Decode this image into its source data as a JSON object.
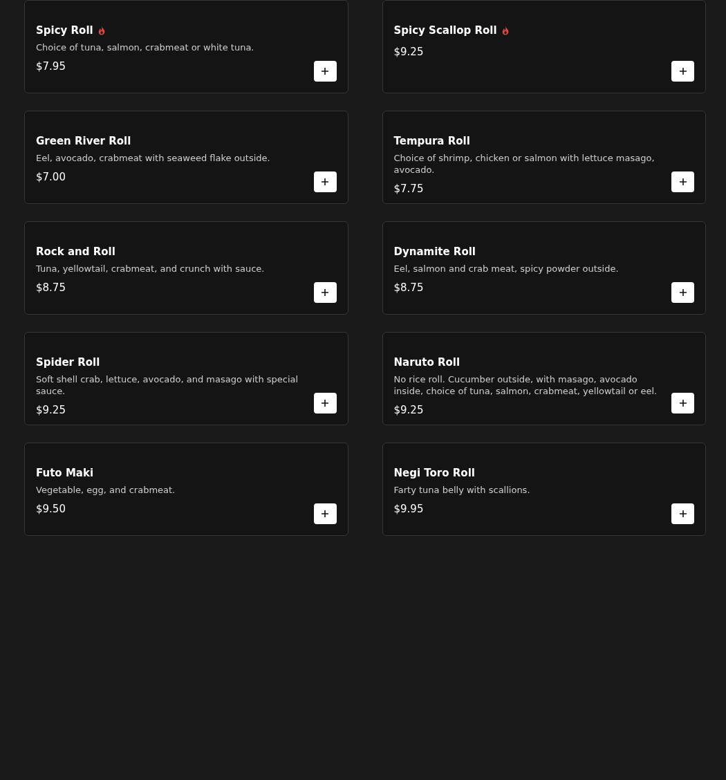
{
  "items": [
    {
      "name": "Spicy Roll",
      "spicy": true,
      "description": "Choice of tuna, salmon, crabmeat or white tuna.",
      "price": "$7.95"
    },
    {
      "name": "Spicy Scallop Roll",
      "spicy": true,
      "price": "$9.25"
    },
    {
      "name": "Green River Roll",
      "spicy": false,
      "description": "Eel, avocado, crabmeat with seaweed flake outside.",
      "price": "$7.00"
    },
    {
      "name": "Tempura Roll",
      "spicy": false,
      "description": "Choice of shrimp, chicken or salmon with lettuce masago, avocado.",
      "price": "$7.75"
    },
    {
      "name": "Rock and Roll",
      "spicy": false,
      "description": "Tuna, yellowtail, crabmeat, and crunch with sauce.",
      "price": "$8.75"
    },
    {
      "name": "Dynamite Roll",
      "spicy": false,
      "description": "Eel, salmon and crab meat, spicy powder outside.",
      "price": "$8.75"
    },
    {
      "name": "Spider Roll",
      "spicy": false,
      "description": "Soft shell crab, lettuce, avocado, and masago with special sauce.",
      "price": "$9.25"
    },
    {
      "name": "Naruto Roll",
      "spicy": false,
      "description": "No rice roll. Cucumber outside, with masago, avocado inside, choice of tuna, salmon, crabmeat, yellowtail or eel.",
      "price": "$9.25"
    },
    {
      "name": "Futo Maki",
      "spicy": false,
      "description": "Vegetable, egg, and crabmeat.",
      "price": "$9.50"
    },
    {
      "name": "Negi Toro Roll",
      "spicy": false,
      "description": "Farty tuna belly with scallions.",
      "price": "$9.95"
    }
  ]
}
